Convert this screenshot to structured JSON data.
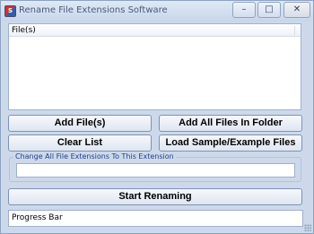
{
  "window": {
    "title": "Rename File Extensions Software",
    "controls": {
      "minimize": "–",
      "maximize": "□",
      "close": "✕"
    }
  },
  "file_list": {
    "column_header": "File(s)",
    "items": []
  },
  "buttons": {
    "add_files": "Add File(s)",
    "add_all_files": "Add All Files In Folder",
    "clear_list": "Clear List",
    "load_sample": "Load Sample/Example Files",
    "start_renaming": "Start Renaming"
  },
  "extension_group": {
    "label": "Change All File Extensions To This  Extension",
    "value": ""
  },
  "progress": {
    "label": "Progress Bar",
    "value": 0
  },
  "colors": {
    "window_background": "#cdd9ea",
    "group_label": "#1e3f8a"
  }
}
